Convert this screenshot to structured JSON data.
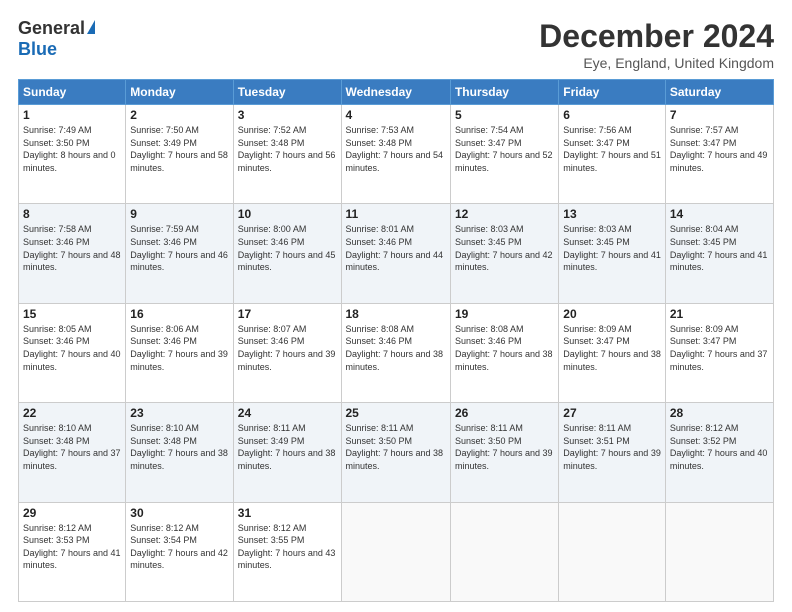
{
  "logo": {
    "general": "General",
    "blue": "Blue"
  },
  "title": "December 2024",
  "subtitle": "Eye, England, United Kingdom",
  "header_days": [
    "Sunday",
    "Monday",
    "Tuesday",
    "Wednesday",
    "Thursday",
    "Friday",
    "Saturday"
  ],
  "weeks": [
    [
      {
        "day": 1,
        "sunrise": "Sunrise: 7:49 AM",
        "sunset": "Sunset: 3:50 PM",
        "daylight": "Daylight: 8 hours and 0 minutes."
      },
      {
        "day": 2,
        "sunrise": "Sunrise: 7:50 AM",
        "sunset": "Sunset: 3:49 PM",
        "daylight": "Daylight: 7 hours and 58 minutes."
      },
      {
        "day": 3,
        "sunrise": "Sunrise: 7:52 AM",
        "sunset": "Sunset: 3:48 PM",
        "daylight": "Daylight: 7 hours and 56 minutes."
      },
      {
        "day": 4,
        "sunrise": "Sunrise: 7:53 AM",
        "sunset": "Sunset: 3:48 PM",
        "daylight": "Daylight: 7 hours and 54 minutes."
      },
      {
        "day": 5,
        "sunrise": "Sunrise: 7:54 AM",
        "sunset": "Sunset: 3:47 PM",
        "daylight": "Daylight: 7 hours and 52 minutes."
      },
      {
        "day": 6,
        "sunrise": "Sunrise: 7:56 AM",
        "sunset": "Sunset: 3:47 PM",
        "daylight": "Daylight: 7 hours and 51 minutes."
      },
      {
        "day": 7,
        "sunrise": "Sunrise: 7:57 AM",
        "sunset": "Sunset: 3:47 PM",
        "daylight": "Daylight: 7 hours and 49 minutes."
      }
    ],
    [
      {
        "day": 8,
        "sunrise": "Sunrise: 7:58 AM",
        "sunset": "Sunset: 3:46 PM",
        "daylight": "Daylight: 7 hours and 48 minutes."
      },
      {
        "day": 9,
        "sunrise": "Sunrise: 7:59 AM",
        "sunset": "Sunset: 3:46 PM",
        "daylight": "Daylight: 7 hours and 46 minutes."
      },
      {
        "day": 10,
        "sunrise": "Sunrise: 8:00 AM",
        "sunset": "Sunset: 3:46 PM",
        "daylight": "Daylight: 7 hours and 45 minutes."
      },
      {
        "day": 11,
        "sunrise": "Sunrise: 8:01 AM",
        "sunset": "Sunset: 3:46 PM",
        "daylight": "Daylight: 7 hours and 44 minutes."
      },
      {
        "day": 12,
        "sunrise": "Sunrise: 8:03 AM",
        "sunset": "Sunset: 3:45 PM",
        "daylight": "Daylight: 7 hours and 42 minutes."
      },
      {
        "day": 13,
        "sunrise": "Sunrise: 8:03 AM",
        "sunset": "Sunset: 3:45 PM",
        "daylight": "Daylight: 7 hours and 41 minutes."
      },
      {
        "day": 14,
        "sunrise": "Sunrise: 8:04 AM",
        "sunset": "Sunset: 3:45 PM",
        "daylight": "Daylight: 7 hours and 41 minutes."
      }
    ],
    [
      {
        "day": 15,
        "sunrise": "Sunrise: 8:05 AM",
        "sunset": "Sunset: 3:46 PM",
        "daylight": "Daylight: 7 hours and 40 minutes."
      },
      {
        "day": 16,
        "sunrise": "Sunrise: 8:06 AM",
        "sunset": "Sunset: 3:46 PM",
        "daylight": "Daylight: 7 hours and 39 minutes."
      },
      {
        "day": 17,
        "sunrise": "Sunrise: 8:07 AM",
        "sunset": "Sunset: 3:46 PM",
        "daylight": "Daylight: 7 hours and 39 minutes."
      },
      {
        "day": 18,
        "sunrise": "Sunrise: 8:08 AM",
        "sunset": "Sunset: 3:46 PM",
        "daylight": "Daylight: 7 hours and 38 minutes."
      },
      {
        "day": 19,
        "sunrise": "Sunrise: 8:08 AM",
        "sunset": "Sunset: 3:46 PM",
        "daylight": "Daylight: 7 hours and 38 minutes."
      },
      {
        "day": 20,
        "sunrise": "Sunrise: 8:09 AM",
        "sunset": "Sunset: 3:47 PM",
        "daylight": "Daylight: 7 hours and 38 minutes."
      },
      {
        "day": 21,
        "sunrise": "Sunrise: 8:09 AM",
        "sunset": "Sunset: 3:47 PM",
        "daylight": "Daylight: 7 hours and 37 minutes."
      }
    ],
    [
      {
        "day": 22,
        "sunrise": "Sunrise: 8:10 AM",
        "sunset": "Sunset: 3:48 PM",
        "daylight": "Daylight: 7 hours and 37 minutes."
      },
      {
        "day": 23,
        "sunrise": "Sunrise: 8:10 AM",
        "sunset": "Sunset: 3:48 PM",
        "daylight": "Daylight: 7 hours and 38 minutes."
      },
      {
        "day": 24,
        "sunrise": "Sunrise: 8:11 AM",
        "sunset": "Sunset: 3:49 PM",
        "daylight": "Daylight: 7 hours and 38 minutes."
      },
      {
        "day": 25,
        "sunrise": "Sunrise: 8:11 AM",
        "sunset": "Sunset: 3:50 PM",
        "daylight": "Daylight: 7 hours and 38 minutes."
      },
      {
        "day": 26,
        "sunrise": "Sunrise: 8:11 AM",
        "sunset": "Sunset: 3:50 PM",
        "daylight": "Daylight: 7 hours and 39 minutes."
      },
      {
        "day": 27,
        "sunrise": "Sunrise: 8:11 AM",
        "sunset": "Sunset: 3:51 PM",
        "daylight": "Daylight: 7 hours and 39 minutes."
      },
      {
        "day": 28,
        "sunrise": "Sunrise: 8:12 AM",
        "sunset": "Sunset: 3:52 PM",
        "daylight": "Daylight: 7 hours and 40 minutes."
      }
    ],
    [
      {
        "day": 29,
        "sunrise": "Sunrise: 8:12 AM",
        "sunset": "Sunset: 3:53 PM",
        "daylight": "Daylight: 7 hours and 41 minutes."
      },
      {
        "day": 30,
        "sunrise": "Sunrise: 8:12 AM",
        "sunset": "Sunset: 3:54 PM",
        "daylight": "Daylight: 7 hours and 42 minutes."
      },
      {
        "day": 31,
        "sunrise": "Sunrise: 8:12 AM",
        "sunset": "Sunset: 3:55 PM",
        "daylight": "Daylight: 7 hours and 43 minutes."
      },
      null,
      null,
      null,
      null
    ]
  ]
}
